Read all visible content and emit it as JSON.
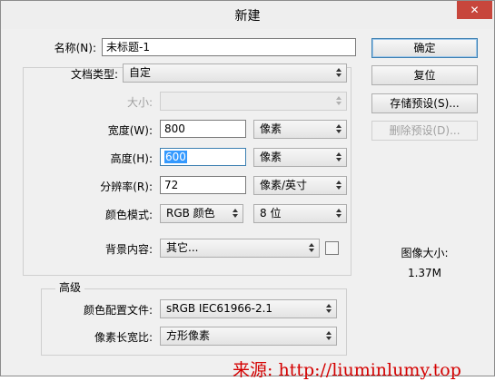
{
  "window": {
    "title": "新建",
    "close_label": "✕"
  },
  "form": {
    "name_label": "名称(N):",
    "name_value": "未标题-1",
    "preset_label": "文档类型:",
    "preset_value": "自定",
    "size_label": "大小:",
    "size_value": "",
    "width_label": "宽度(W):",
    "width_value": "800",
    "width_unit": "像素",
    "height_label": "高度(H):",
    "height_value": "600",
    "height_unit": "像素",
    "resolution_label": "分辨率(R):",
    "resolution_value": "72",
    "resolution_unit": "像素/英寸",
    "color_mode_label": "颜色模式:",
    "color_mode_value": "RGB 颜色",
    "bit_depth_value": "8 位",
    "background_label": "背景内容:",
    "background_value": "其它..."
  },
  "advanced": {
    "legend": "高级",
    "color_profile_label": "颜色配置文件:",
    "color_profile_value": "sRGB IEC61966-2.1",
    "pixel_aspect_label": "像素长宽比:",
    "pixel_aspect_value": "方形像素"
  },
  "buttons": {
    "ok": "确定",
    "reset": "复位",
    "save_preset": "存储预设(S)...",
    "delete_preset": "删除预设(D)..."
  },
  "image_size": {
    "label": "图像大小:",
    "value": "1.37M"
  },
  "watermark": "来源: http://liuminlumy.top",
  "colors": {
    "close_button": "#c7463c",
    "selection": "#3399ff",
    "watermark": "#d40000"
  }
}
